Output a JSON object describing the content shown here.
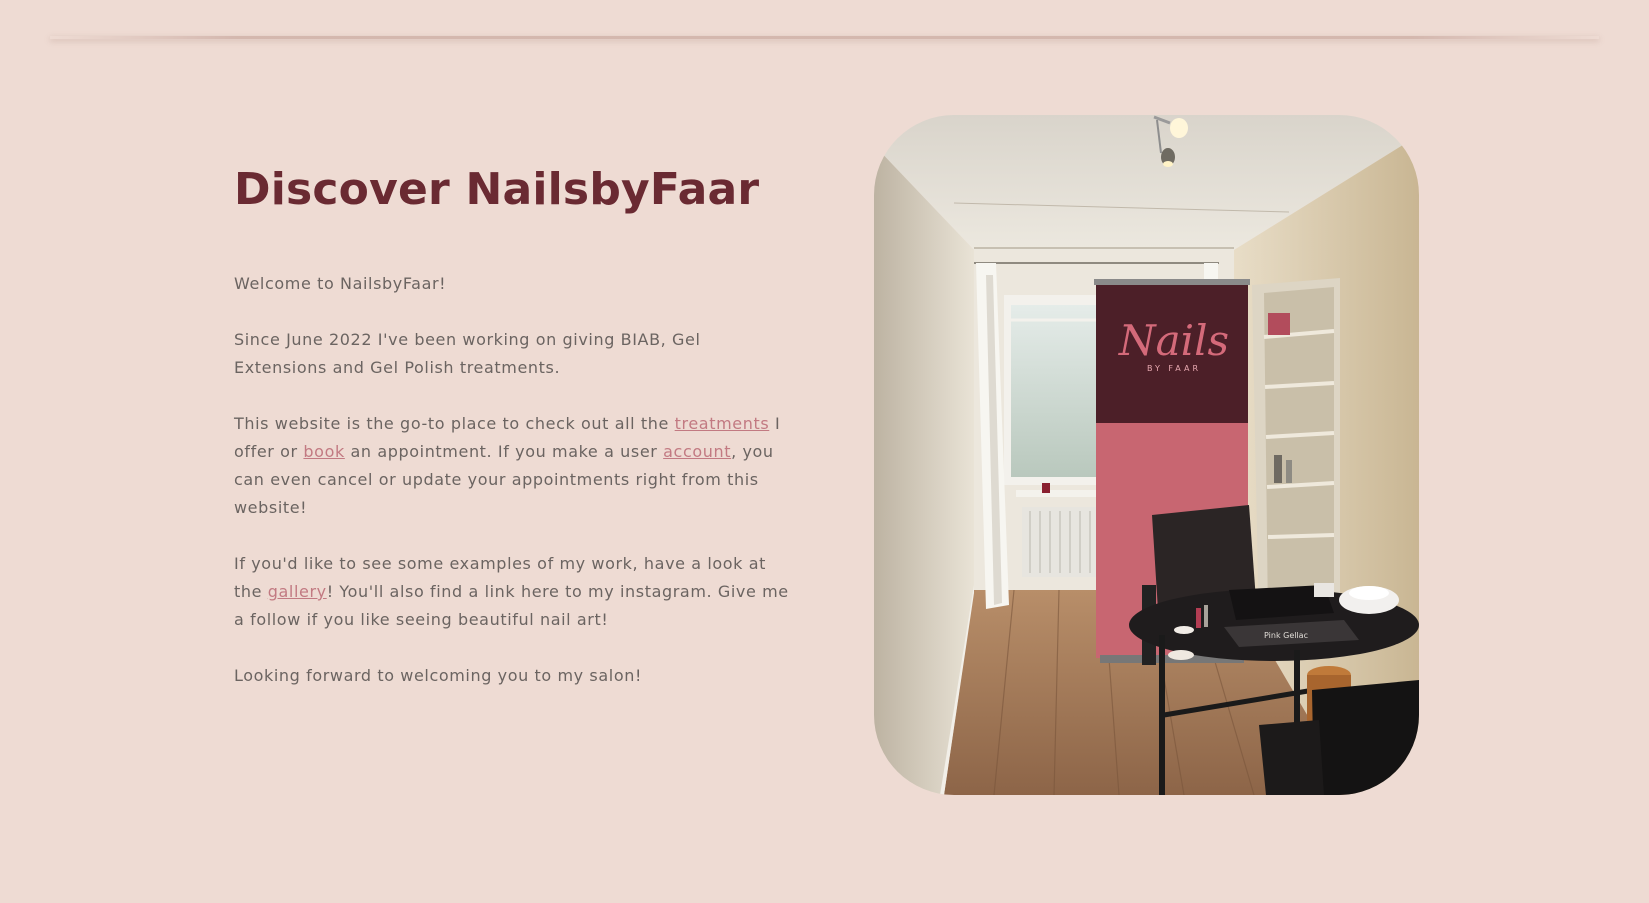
{
  "hero": {
    "title": "Discover NailsbyFaar",
    "welcome": "Welcome to NailsbyFaar!",
    "since": "Since June 2022 I've been working on giving BIAB, Gel Extensions and Gel Polish treatments.",
    "website_before": "This website is the go-to place to check out all the ",
    "treatments_link": "treatments",
    "website_mid1": " I offer or ",
    "book_link": "book",
    "website_mid2": " an appointment. If you make a user ",
    "account_link": "account",
    "website_after": ", you can even cancel or update your appointments right from this website!",
    "gallery_before": "If you'd like to see some examples of my work, have a look at the ",
    "gallery_link": "gallery",
    "gallery_after": "! You'll also find a link here to my instagram. Give me a follow if you like seeing beautiful nail art!",
    "closing": "Looking forward to welcoming you to my salon!"
  },
  "photo": {
    "banner_logo_main": "Nails",
    "banner_logo_sub": "BY FAAR",
    "mat_text": "Pink Gellac"
  },
  "colors": {
    "background": "#eedbd3",
    "title": "#6a2a32",
    "body_text": "#6b6461",
    "link": "#c27a82"
  }
}
